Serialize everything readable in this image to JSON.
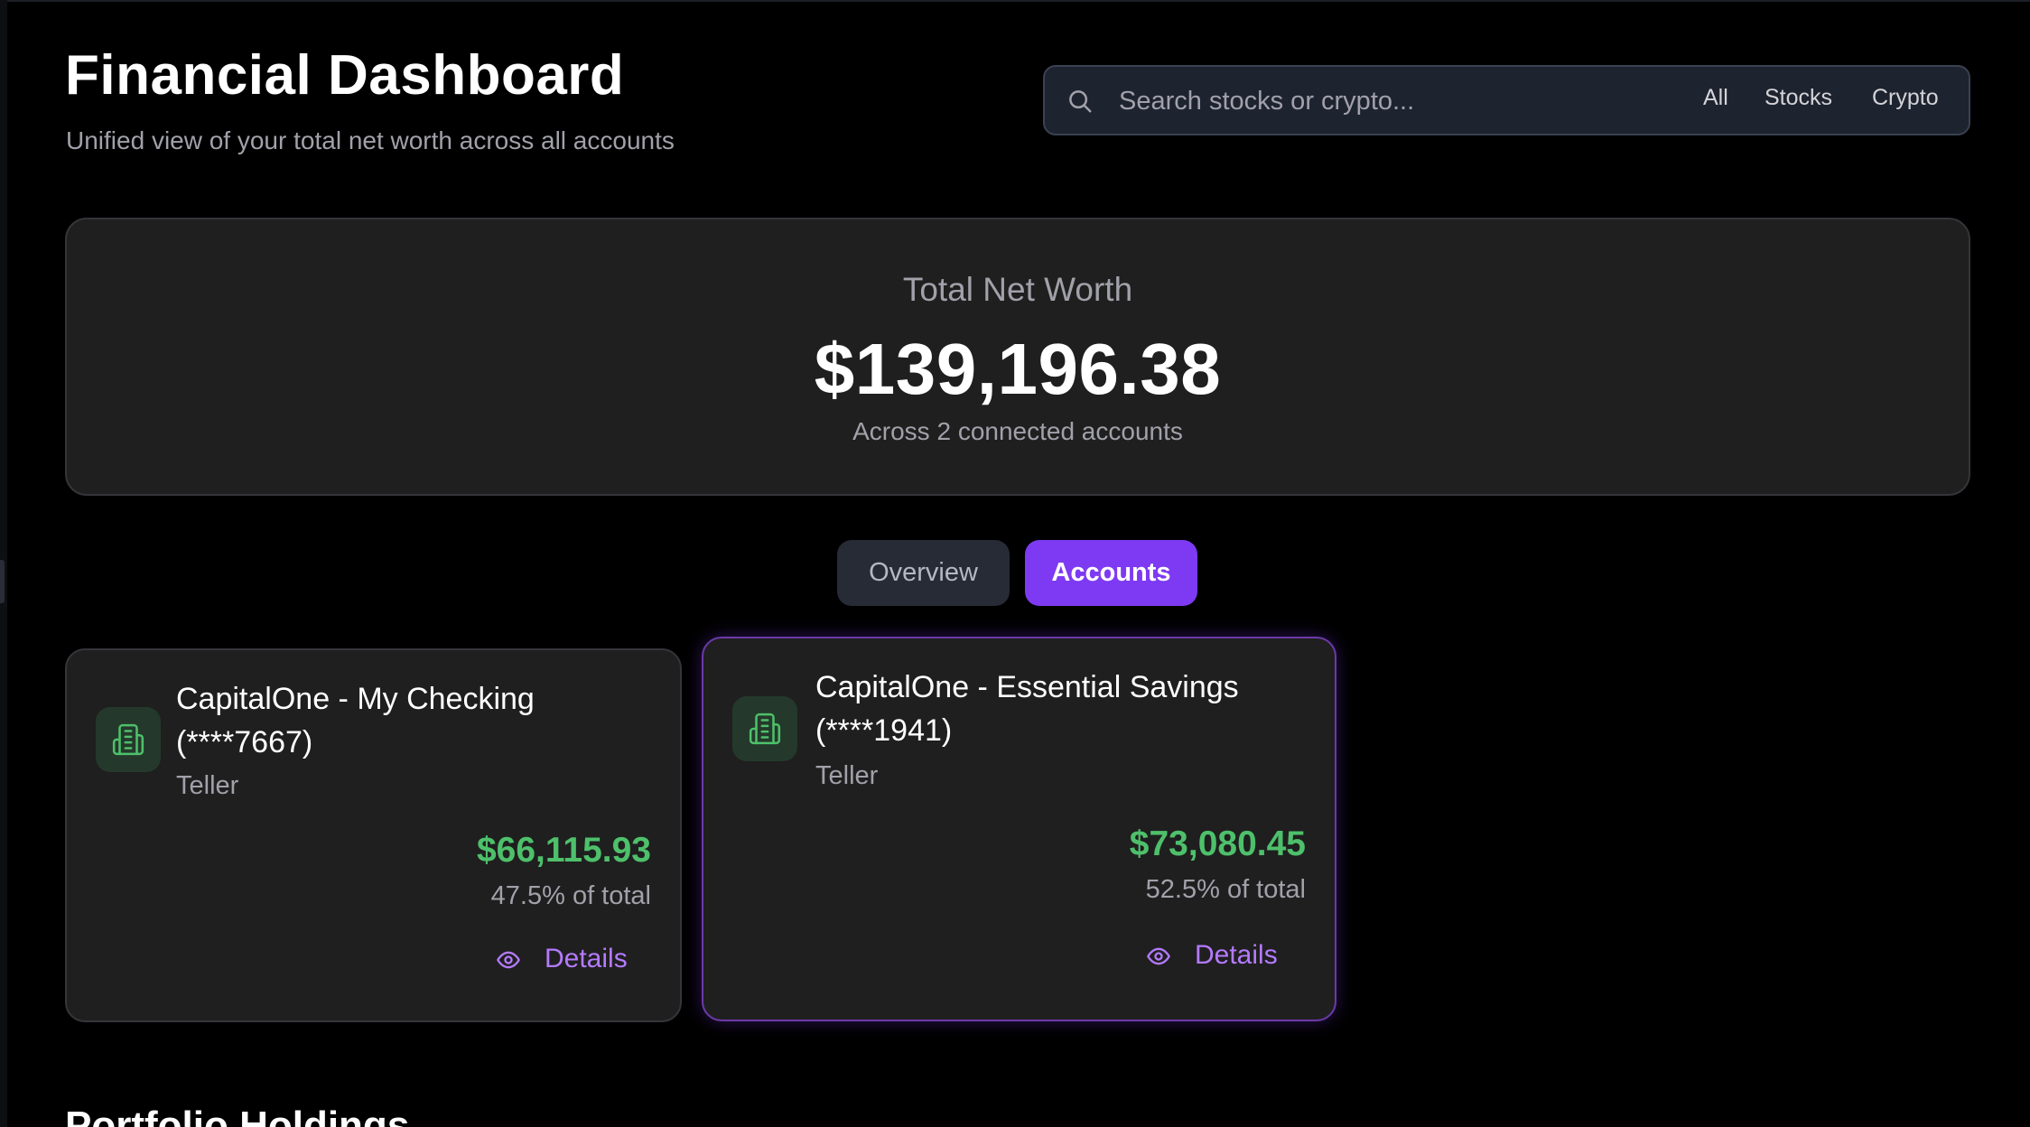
{
  "header": {
    "title": "Financial Dashboard",
    "subtitle": "Unified view of your total net worth across all accounts"
  },
  "search": {
    "placeholder": "Search stocks or crypto...",
    "value": "",
    "icon": "search-icon",
    "filters": [
      "All",
      "Stocks",
      "Crypto"
    ]
  },
  "networth": {
    "label": "Total Net Worth",
    "value": "$139,196.38",
    "caption": "Across 2 connected accounts"
  },
  "tabs": [
    {
      "label": "Overview",
      "active": false
    },
    {
      "label": "Accounts",
      "active": true
    }
  ],
  "accounts": [
    {
      "name_line1": "CapitalOne - My Checking",
      "name_line2": "(****7667)",
      "provider": "Teller",
      "balance": "$66,115.93",
      "percent": "47.5% of total",
      "details_label": "Details",
      "icon": "bank-building-icon"
    },
    {
      "name_line1": "CapitalOne - Essential Savings",
      "name_line2": "(****1941)",
      "provider": "Teller",
      "balance": "$73,080.45",
      "percent": "52.5% of total",
      "details_label": "Details",
      "icon": "bank-building-icon"
    }
  ],
  "sections": {
    "portfolio_title": "Portfolio Holdings"
  },
  "colors": {
    "accent": "#7e3af2",
    "positive": "#4ec06b",
    "link": "#b47aff",
    "card_bg": "#1f1f1f"
  }
}
